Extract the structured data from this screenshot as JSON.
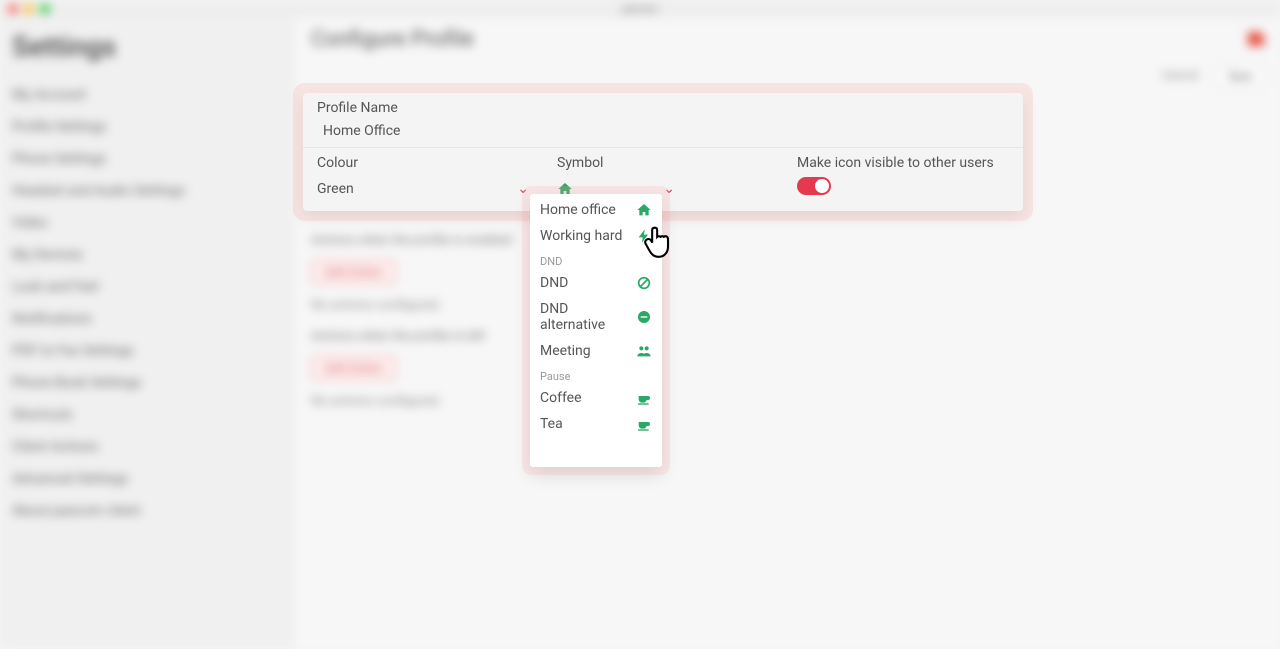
{
  "window": {
    "title": "pascom"
  },
  "sidebar": {
    "title": "Settings",
    "items": [
      "My Account",
      "Profile Settings",
      "Phone Settings",
      "Headset and Audio Settings",
      "Video",
      "My Devices",
      "Look and Feel",
      "Notifications",
      "PDF to Fax Settings",
      "Phone Book Settings",
      "Shortcuts",
      "Client Actions",
      "Advanced Settings",
      "About pascom client"
    ]
  },
  "main": {
    "title": "Configure Profile",
    "cancel": "Cancel",
    "save": "Save",
    "sec_enabled": "Actions when the profile is enabled",
    "sec_left": "Actions when the profile is left",
    "add_action": "Add Action",
    "no_actions": "No actions configured."
  },
  "panel": {
    "name_label": "Profile Name",
    "name_value": "Home Office",
    "colour_label": "Colour",
    "colour_value": "Green",
    "symbol_label": "Symbol",
    "visible_label": "Make icon visible to other users"
  },
  "dropdown": {
    "groups": [
      {
        "label": "",
        "options": [
          {
            "label": "Home office",
            "icon": "home-icon"
          },
          {
            "label": "Working hard",
            "icon": "bolt-icon"
          }
        ]
      },
      {
        "label": "DND",
        "options": [
          {
            "label": "DND",
            "icon": "dnd-icon"
          },
          {
            "label": "DND alternative",
            "icon": "minus-circle-icon"
          },
          {
            "label": "Meeting",
            "icon": "people-icon"
          }
        ]
      },
      {
        "label": "Pause",
        "options": [
          {
            "label": "Coffee",
            "icon": "cup-icon"
          },
          {
            "label": "Tea",
            "icon": "cup-icon"
          }
        ]
      }
    ]
  }
}
